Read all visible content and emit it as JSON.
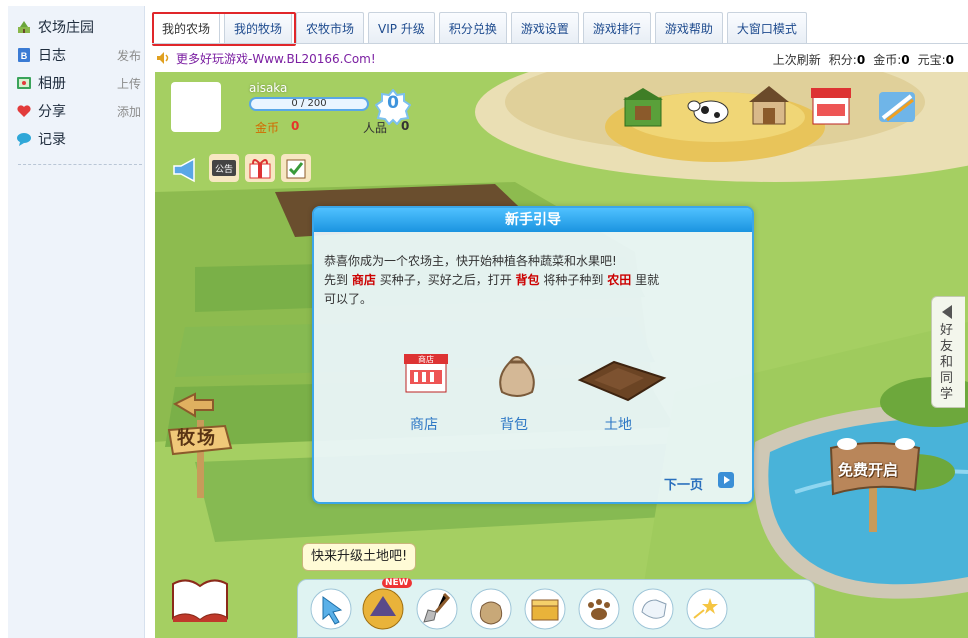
{
  "sidebar": {
    "items": [
      {
        "label": "农场庄园",
        "action": "",
        "icon": "farm-icon",
        "icon_color": "#6aa53a"
      },
      {
        "label": "日志",
        "action": "发布",
        "icon": "blog-icon",
        "icon_color": "#3b7bd4"
      },
      {
        "label": "相册",
        "action": "上传",
        "icon": "album-icon",
        "icon_color": "#3aa35a"
      },
      {
        "label": "分享",
        "action": "添加",
        "icon": "share-icon",
        "icon_color": "#e23b3b"
      },
      {
        "label": "记录",
        "action": "",
        "icon": "record-icon",
        "icon_color": "#2fa7d8"
      }
    ]
  },
  "tabs": [
    {
      "label": "我的农场",
      "active": true
    },
    {
      "label": "我的牧场",
      "active": false
    },
    {
      "label": "农牧市场",
      "active": false
    },
    {
      "label": "VIP 升级",
      "active": false
    },
    {
      "label": "积分兑换",
      "active": false
    },
    {
      "label": "游戏设置",
      "active": false
    },
    {
      "label": "游戏排行",
      "active": false
    },
    {
      "label": "游戏帮助",
      "active": false
    },
    {
      "label": "大窗口模式",
      "active": false
    }
  ],
  "info_bar": {
    "promo": "更多好玩游戏-Www.BL20166.Com!",
    "refresh": "上次刷新",
    "points_label": "积分:",
    "points": "0",
    "coins_label": "金币:",
    "coins": "0",
    "yuanbao_label": "元宝:",
    "yuanbao": "0"
  },
  "player": {
    "name": "aisaka",
    "exp": "0 / 200",
    "exp_fraction": 0,
    "level": "0",
    "gold_label": "金币",
    "gold": "0",
    "popularity_label": "人品",
    "popularity": "0"
  },
  "notice_label": "公告",
  "signs": {
    "ranch": "牧场",
    "free_open": "免费开启"
  },
  "friends_tab": "好友和同学",
  "dialog": {
    "title": "新手引导",
    "line1": "恭喜你成为一个农场主，快开始种植各种蔬菜和水果吧!",
    "line2_a": "先到",
    "line2_shop": "商店",
    "line2_b": "买种子，买好之后，打开",
    "line2_bag": "背包",
    "line2_c": "将种子种到",
    "line2_field": "农田",
    "line2_d": "里就",
    "line3": "可以了。",
    "shop_sign": "商店",
    "items": [
      {
        "label": "商店",
        "icon": "shop-icon"
      },
      {
        "label": "背包",
        "icon": "bag-icon"
      },
      {
        "label": "土地",
        "icon": "land-icon"
      }
    ],
    "next": "下一页"
  },
  "tooltip": "快来升级土地吧!",
  "new_badge": "NEW",
  "toolbar_tools": [
    "cursor-tool-icon",
    "upgrade-tool-icon",
    "shovel-tool-icon",
    "seed-bag-tool-icon",
    "treasure-chest-tool-icon",
    "paw-tool-icon",
    "glove-tool-icon",
    "shooting-star-tool-icon"
  ],
  "colors": {
    "accent_blue": "#1b94e0",
    "highlight_red": "#e0262a",
    "grass": "#a9d16a"
  }
}
